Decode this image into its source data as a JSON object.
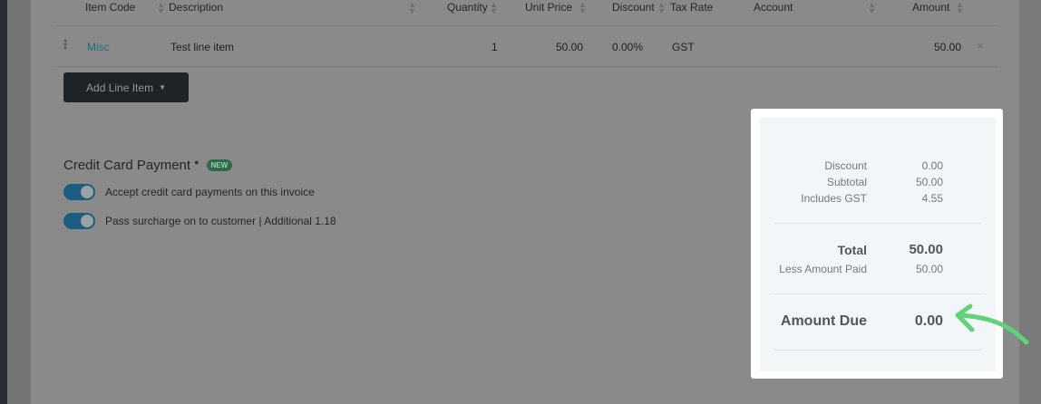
{
  "table": {
    "headers": {
      "item_code": "Item Code",
      "description": "Description",
      "quantity": "Quantity",
      "unit_price": "Unit Price",
      "discount": "Discount",
      "tax_rate": "Tax Rate",
      "account": "Account",
      "amount": "Amount"
    },
    "rows": [
      {
        "item_code": "Misc",
        "description": "Test line item",
        "quantity": "1",
        "unit_price": "50.00",
        "discount": "0.00%",
        "tax_rate": "GST",
        "account": "",
        "amount": "50.00"
      }
    ]
  },
  "actions": {
    "add_line_item": "Add Line Item"
  },
  "credit_card": {
    "title": "Credit Card Payment",
    "badge": "NEW",
    "options": [
      {
        "label": "Accept credit card payments on this invoice",
        "enabled": true
      },
      {
        "label": "Pass surcharge on to customer | Additional 1.18",
        "enabled": true
      }
    ]
  },
  "totals": {
    "discount_label": "Discount",
    "discount_value": "0.00",
    "subtotal_label": "Subtotal",
    "subtotal_value": "50.00",
    "gst_label": "Includes GST",
    "gst_value": "4.55",
    "total_label": "Total",
    "total_value": "50.00",
    "paid_label": "Less Amount Paid",
    "paid_value": "50.00",
    "due_label": "Amount Due",
    "due_value": "0.00"
  },
  "colors": {
    "link": "#1d6f85",
    "toggle_on": "#1c5d80",
    "badge": "#2e6b48",
    "highlight_arrow": "#5fd27a"
  },
  "icons": {
    "drag": "drag-handle-icon",
    "sort": "sort-icon",
    "remove": "close-icon",
    "caret": "caret-down-icon",
    "info": "info-icon",
    "arrow": "annotation-arrow-icon"
  }
}
